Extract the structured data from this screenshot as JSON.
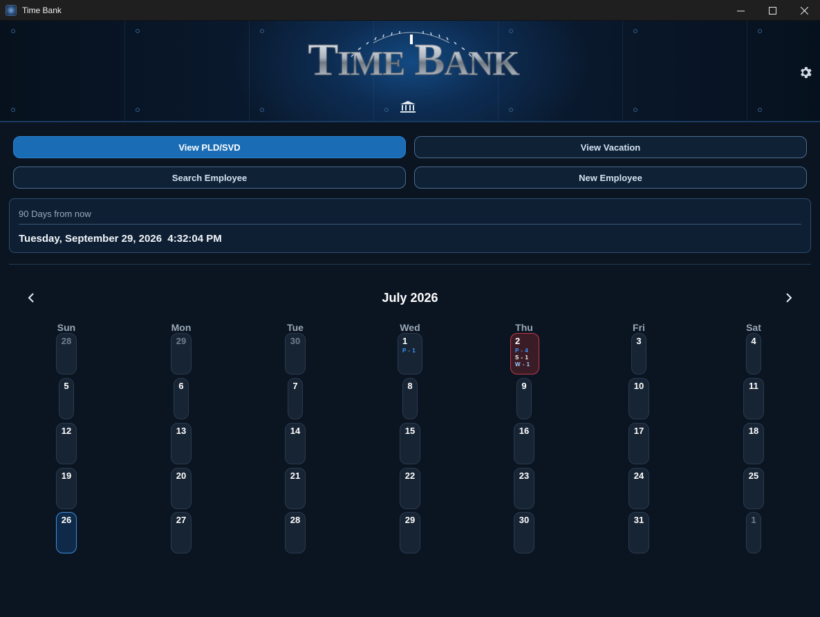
{
  "window": {
    "title": "Time Bank",
    "controls": [
      "minimize",
      "maximize",
      "close"
    ]
  },
  "banner": {
    "logo_big_t": "T",
    "logo_ime": "IME",
    "logo_big_b": "B",
    "logo_ank": "ANK",
    "icons": [
      "gauge-icon",
      "bank-icon",
      "gear-icon"
    ]
  },
  "buttons": {
    "view_pld": "View PLD/SVD",
    "view_vacation": "View Vacation",
    "search_employee": "Search Employee",
    "new_employee": "New Employee"
  },
  "info": {
    "label": "90 Days from now",
    "value": "Tuesday, September 29, 2026  4:32:04 PM"
  },
  "calendar": {
    "month_label": "July 2026",
    "weekdays": [
      "Sun",
      "Mon",
      "Tue",
      "Wed",
      "Thu",
      "Fri",
      "Sat"
    ],
    "weeks": [
      [
        "28",
        "29",
        "30",
        "1",
        "2",
        "3",
        "4"
      ],
      [
        "5",
        "6",
        "7",
        "8",
        "9",
        "10",
        "11"
      ],
      [
        "12",
        "13",
        "14",
        "15",
        "16",
        "17",
        "18"
      ],
      [
        "19",
        "20",
        "21",
        "22",
        "23",
        "24",
        "25"
      ],
      [
        "26",
        "27",
        "28",
        "29",
        "30",
        "31",
        "1"
      ]
    ],
    "other_month_cells": [
      [
        0,
        0
      ],
      [
        0,
        1
      ],
      [
        0,
        2
      ],
      [
        4,
        6
      ]
    ],
    "today_cell": [
      4,
      0
    ],
    "entries": {
      "wed_1": [
        "P - 1"
      ],
      "thu_2": [
        "P - 4",
        "S - 1",
        "W - 1"
      ]
    },
    "colors": {
      "P": "#3d9bff",
      "S": "#ffffff",
      "W": "#9fcfff",
      "accent": "#1a6db5",
      "flag": "#c03a4a"
    }
  }
}
